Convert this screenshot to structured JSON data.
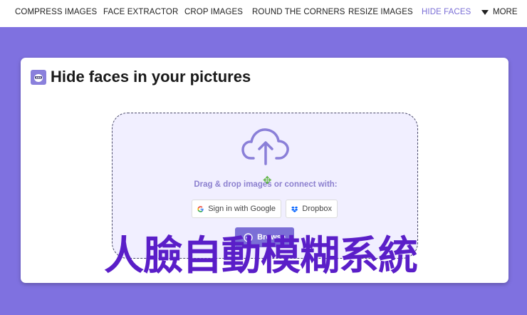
{
  "nav": {
    "items": [
      {
        "label": "COMPRESS IMAGES"
      },
      {
        "label": "FACE EXTRACTOR"
      },
      {
        "label": "CROP IMAGES"
      },
      {
        "label": "ROUND THE CORNERS"
      },
      {
        "label": "RESIZE IMAGES"
      },
      {
        "label": "HIDE FACES"
      }
    ],
    "more_label": "MORE",
    "active_color": "#7b6fd6"
  },
  "card": {
    "title": "Hide faces in your pictures",
    "title_icon": "face-blur-icon"
  },
  "dropzone": {
    "upload_icon": "cloud-upload-icon",
    "prompt": "Drag & drop images or connect with:",
    "google_label": "Sign in with Google",
    "dropbox_label": "Dropbox",
    "browse_label": "Browse"
  },
  "overlay": {
    "caption": "人臉自動模糊系統"
  },
  "colors": {
    "background": "#7f71e0",
    "accent": "#7b6fd6",
    "dropzone_bg": "#f1efff",
    "caption": "#5a1ec8"
  }
}
